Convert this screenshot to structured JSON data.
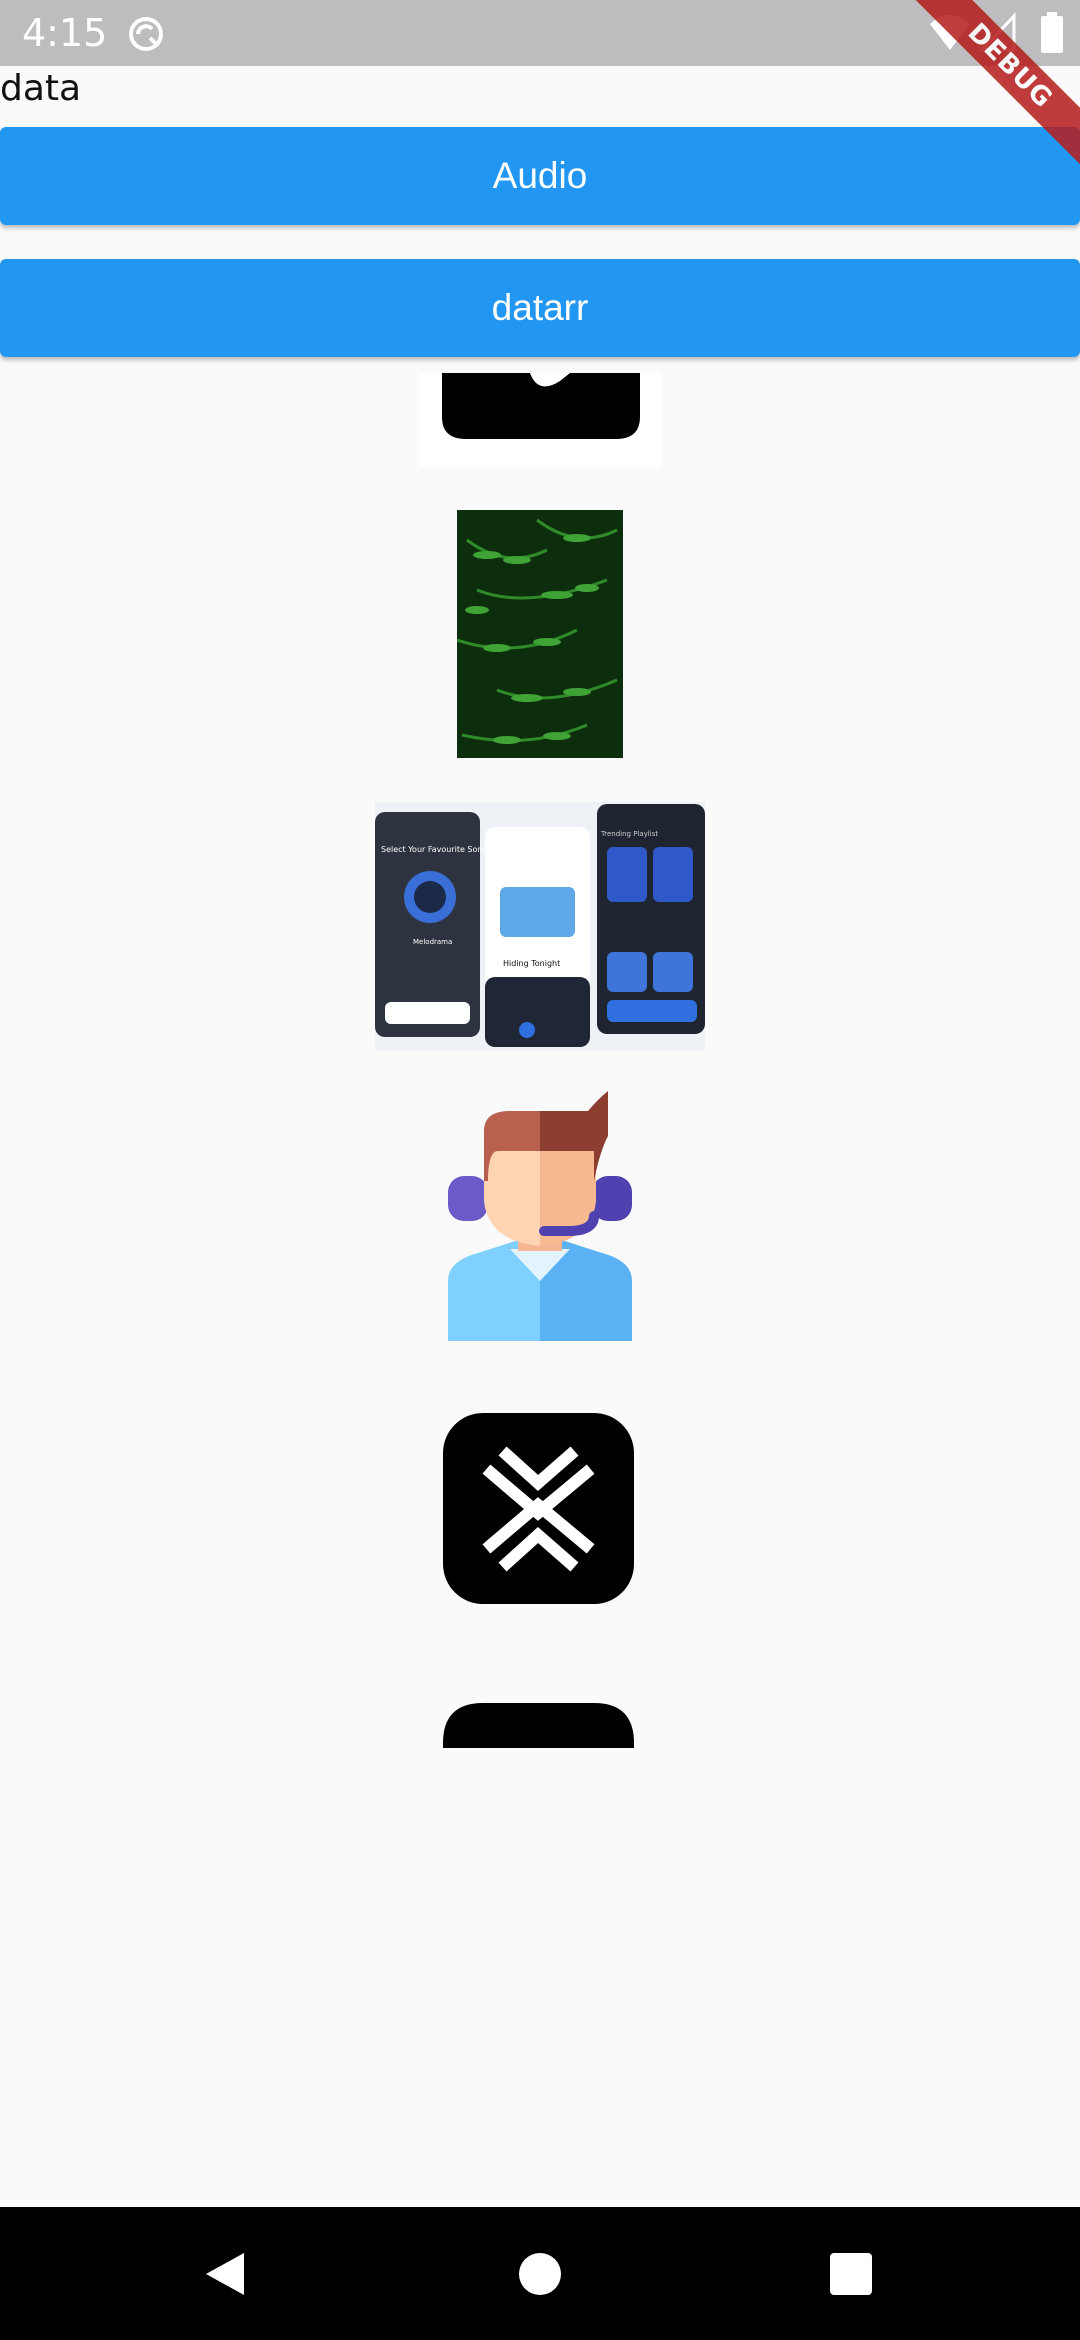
{
  "status_bar": {
    "time": "4:15",
    "icons": [
      "sync-icon",
      "wifi-icon",
      "signal-icon",
      "battery-icon"
    ]
  },
  "debug_banner": "DEBUG",
  "header": {
    "label": "data"
  },
  "buttons": {
    "audio_label": "Audio",
    "datarr_label": "datarr"
  },
  "colors": {
    "accent": "#2196f3",
    "status_bar": "#bdbdbd",
    "background": "#fafafa"
  },
  "images": [
    {
      "name": "black-app-logo"
    },
    {
      "name": "fern-leaves-photo"
    },
    {
      "name": "music-app-screens"
    },
    {
      "name": "support-agent-avatar"
    },
    {
      "name": "x-arrows-logo"
    },
    {
      "name": "black-app-logo"
    }
  ],
  "music_app_text": {
    "select_song": "Select Your Favourite Song",
    "song_title": "Melodrama",
    "now_playing": "Hiding Tonight",
    "trending": "Trending Playlist"
  },
  "nav": {
    "icons": [
      "back-icon",
      "home-icon",
      "recents-icon"
    ]
  }
}
